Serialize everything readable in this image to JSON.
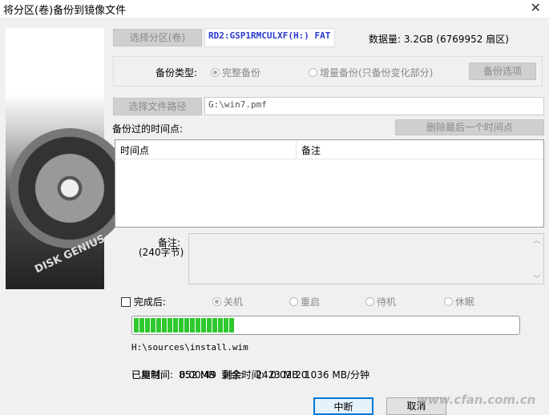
{
  "window": {
    "title": "将分区(卷)备份到镜像文件",
    "close": "✕"
  },
  "side": {
    "brand": "DISK GENIUS"
  },
  "source": {
    "button": "选择分区(卷)",
    "value": "RD2:GSP1RMCULXF(H:) FAT",
    "data_label": "数据量:",
    "data_value": "3.2GB (6769952 扇区)"
  },
  "backup_type": {
    "label": "备份类型:",
    "full": "完整备份",
    "incremental": "增量备份(只备份变化部分)",
    "options_button": "备份选项",
    "selected": "full"
  },
  "path": {
    "button": "选择文件路径",
    "value": "G:\\win7.pmf"
  },
  "timepoints": {
    "label": "备份过的时间点:",
    "delete_button": "删除最后一个时间点",
    "columns": [
      "时间点",
      "备注"
    ],
    "rows": []
  },
  "note": {
    "label": "备注:",
    "hint": "(240字节)",
    "value": ""
  },
  "after": {
    "label": "完成后:",
    "checked": false,
    "options": [
      "关机",
      "重启",
      "待机",
      "休眠"
    ],
    "selected": 0
  },
  "progress": {
    "percent": 26,
    "color": "#2ec82e"
  },
  "status": {
    "file": "H:\\sources\\install.wim",
    "copied_label": "已复制:",
    "copied": "852 MB",
    "remaining_label": "剩余:",
    "remaining": "2423 MB",
    "speed": "1036 MB/分钟",
    "elapsed_label": "已用时间:",
    "elapsed": "0:00:49",
    "left_label": "剩余时间:",
    "left": "0:02:20"
  },
  "buttons": {
    "abort": "中断",
    "cancel": "取消"
  },
  "watermark": "www.cfan.com.cn"
}
